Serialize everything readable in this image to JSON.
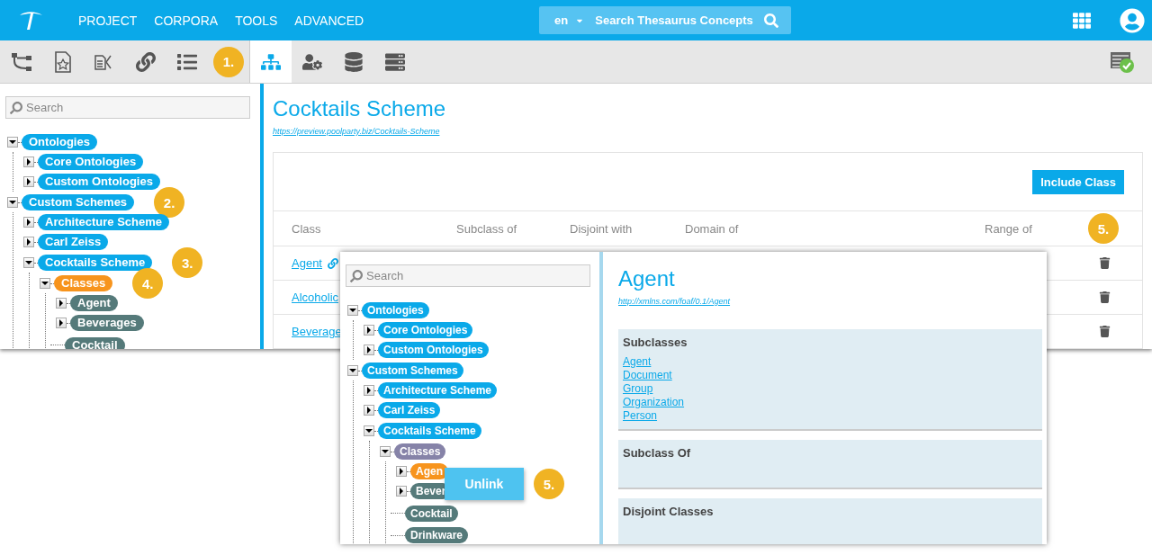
{
  "topbar": {
    "nav": [
      "PROJECT",
      "CORPORA",
      "TOOLS",
      "ADVANCED"
    ],
    "search": {
      "language": "en",
      "placeholder": "Search Thesaurus Concepts"
    }
  },
  "toolbar": {
    "tools": [
      {
        "kind": "tree",
        "selected": false
      },
      {
        "kind": "bookmark",
        "selected": false
      },
      {
        "kind": "mapping",
        "selected": false
      },
      {
        "kind": "link",
        "selected": false
      },
      {
        "kind": "list",
        "selected": false
      },
      {
        "kind": "callout",
        "label": "1."
      },
      {
        "kind": "hierarchy",
        "selected": true
      },
      {
        "kind": "users",
        "selected": false
      },
      {
        "kind": "database",
        "selected": false
      },
      {
        "kind": "server",
        "selected": false
      }
    ]
  },
  "sidebar": {
    "search": {
      "placeholder": "Search"
    },
    "tree": [
      {
        "label": "Ontologies",
        "kind": "branch",
        "expanded": true,
        "color": "#0aa9e9",
        "children": [
          {
            "label": "Core Ontologies",
            "kind": "branch",
            "expanded": false,
            "color": "#0aa9e9"
          },
          {
            "label": "Custom Ontologies",
            "kind": "branch",
            "expanded": false,
            "color": "#0aa9e9"
          }
        ]
      },
      {
        "label": "Custom Schemes",
        "kind": "branch",
        "expanded": true,
        "color": "#0aa9e9",
        "callout": "2.",
        "children": [
          {
            "label": "Architecture Scheme",
            "kind": "branch",
            "expanded": false,
            "color": "#0aa9e9"
          },
          {
            "label": "Carl Zeiss",
            "kind": "branch",
            "expanded": false,
            "color": "#0aa9e9"
          },
          {
            "label": "Cocktails Scheme",
            "kind": "branch",
            "expanded": true,
            "color": "#0aa9e9",
            "callout": "3.",
            "children": [
              {
                "label": "Classes",
                "kind": "branch",
                "expanded": true,
                "color": "#f7941d",
                "callout": "4.",
                "children": [
                  {
                    "label": "Agent",
                    "kind": "branch",
                    "expanded": false,
                    "color": "#557a7a"
                  },
                  {
                    "label": "Beverages",
                    "kind": "branch",
                    "expanded": false,
                    "color": "#557a7a"
                  },
                  {
                    "label": "Cocktail",
                    "kind": "leaf",
                    "color": "#557a7a"
                  }
                ]
              }
            ]
          }
        ]
      }
    ]
  },
  "main": {
    "title": "Cocktails Scheme",
    "uri": "https://preview.poolparty.biz/Cocktails-Scheme",
    "include_button": "Include Class",
    "columns": [
      "Class",
      "Subclass of",
      "Disjoint with",
      "Domain of",
      "Range of"
    ],
    "callout": "5.",
    "rows": [
      {
        "label": "Agent",
        "linked": true
      },
      {
        "label": "Alcoholic",
        "linked": false
      },
      {
        "label": "Beverage",
        "linked": false
      }
    ]
  },
  "popup": {
    "sidebar": {
      "search": {
        "placeholder": "Search"
      },
      "tree": [
        {
          "label": "Ontologies",
          "kind": "branch",
          "expanded": true,
          "color": "#0aa9e9",
          "children": [
            {
              "label": "Core Ontologies",
              "kind": "branch",
              "expanded": false,
              "color": "#0aa9e9"
            },
            {
              "label": "Custom Ontologies",
              "kind": "branch",
              "expanded": false,
              "color": "#0aa9e9"
            }
          ]
        },
        {
          "label": "Custom Schemes",
          "kind": "branch",
          "expanded": true,
          "color": "#0aa9e9",
          "children": [
            {
              "label": "Architecture Scheme",
              "kind": "branch",
              "expanded": false,
              "color": "#0aa9e9"
            },
            {
              "label": "Carl Zeiss",
              "kind": "branch",
              "expanded": false,
              "color": "#0aa9e9"
            },
            {
              "label": "Cocktails Scheme",
              "kind": "branch",
              "expanded": true,
              "color": "#0aa9e9",
              "children": [
                {
                  "label": "Classes",
                  "kind": "branch",
                  "expanded": true,
                  "color": "#8683a8",
                  "children": [
                    {
                      "label": "Agen",
                      "kind": "branch",
                      "expanded": false,
                      "color": "#f7941d"
                    },
                    {
                      "label": "Bever",
                      "kind": "branch",
                      "expanded": false,
                      "color": "#557a7a"
                    },
                    {
                      "label": "Cocktail",
                      "kind": "leaf",
                      "color": "#557a7a"
                    },
                    {
                      "label": "Drinkware",
                      "kind": "leaf",
                      "color": "#557a7a"
                    }
                  ]
                }
              ]
            }
          ]
        }
      ]
    },
    "title": "Agent",
    "uri": "http://xmlns.com/foaf/0.1/Agent",
    "sections": [
      {
        "heading": "Subclasses",
        "links": [
          "Agent",
          "Document",
          "Group",
          "Organization",
          "Person"
        ]
      },
      {
        "heading": "Subclass Of"
      },
      {
        "heading": "Disjoint Classes"
      }
    ],
    "context_menu": {
      "item": "Unlink",
      "callout": "5."
    }
  }
}
